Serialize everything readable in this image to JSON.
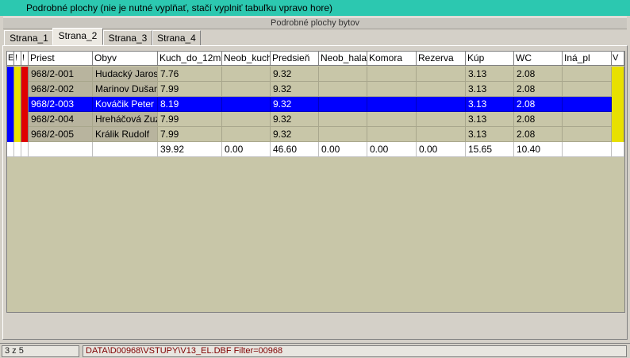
{
  "banner": {
    "text": "Podrobné plochy (nie je nutné vyplňať, stačí vyplniť tabuľku vpravo hore)"
  },
  "panel": {
    "title": "Podrobné plochy bytov"
  },
  "tabs": [
    {
      "label": "Strana_1",
      "active": false
    },
    {
      "label": "Strana_2",
      "active": true
    },
    {
      "label": "Strana_3",
      "active": false
    },
    {
      "label": "Strana_4",
      "active": false
    }
  ],
  "grid": {
    "columns": [
      "E",
      "!",
      "!",
      "Priest",
      "Obyv",
      "Kuch_do_12m",
      "Neob_kuch",
      "Predsieň",
      "Neob_hala",
      "Komora",
      "Rezerva",
      "Kúp",
      "WC",
      "Iná_pl",
      "V"
    ],
    "rows": [
      {
        "priest": "968/2-001",
        "obyv": "Hudacký Jaroslav",
        "kuch": "7.76",
        "neob_kuch": "",
        "predsien": "9.32",
        "neob_hala": "",
        "komora": "",
        "rezerva": "",
        "kup": "3.13",
        "wc": "2.08",
        "ina": "",
        "selected": false
      },
      {
        "priest": "968/2-002",
        "obyv": "Marinov Dušan",
        "kuch": "7.99",
        "neob_kuch": "",
        "predsien": "9.32",
        "neob_hala": "",
        "komora": "",
        "rezerva": "",
        "kup": "3.13",
        "wc": "2.08",
        "ina": "",
        "selected": false
      },
      {
        "priest": "968/2-003",
        "obyv": "Kováčik Peter",
        "kuch": "8.19",
        "neob_kuch": "",
        "predsien": "9.32",
        "neob_hala": "",
        "komora": "",
        "rezerva": "",
        "kup": "3.13",
        "wc": "2.08",
        "ina": "",
        "selected": true
      },
      {
        "priest": "968/2-004",
        "obyv": "Hreháčová Zuzana",
        "kuch": "7.99",
        "neob_kuch": "",
        "predsien": "9.32",
        "neob_hala": "",
        "komora": "",
        "rezerva": "",
        "kup": "3.13",
        "wc": "2.08",
        "ina": "",
        "selected": false
      },
      {
        "priest": "968/2-005",
        "obyv": "Králik Rudolf",
        "kuch": "7.99",
        "neob_kuch": "",
        "predsien": "9.32",
        "neob_hala": "",
        "komora": "",
        "rezerva": "",
        "kup": "3.13",
        "wc": "2.08",
        "ina": "",
        "selected": false
      }
    ],
    "totals": {
      "priest": "",
      "obyv": "",
      "kuch": "39.92",
      "neob_kuch": "0.00",
      "predsien": "46.60",
      "neob_hala": "0.00",
      "komora": "0.00",
      "rezerva": "0.00",
      "kup": "15.65",
      "wc": "10.40",
      "ina": ""
    }
  },
  "status": {
    "count": "3 z 5",
    "path": "DATA\\D00968\\VSTUPY\\V13_EL.DBF Filter=00968"
  },
  "colors": {
    "banner": "#2cc8b0",
    "selection": "#0000ff",
    "marker_blue": "#0000ff",
    "marker_yellow": "#e8e000",
    "marker_red": "#e00000",
    "grid_bg": "#c8c6a8"
  }
}
